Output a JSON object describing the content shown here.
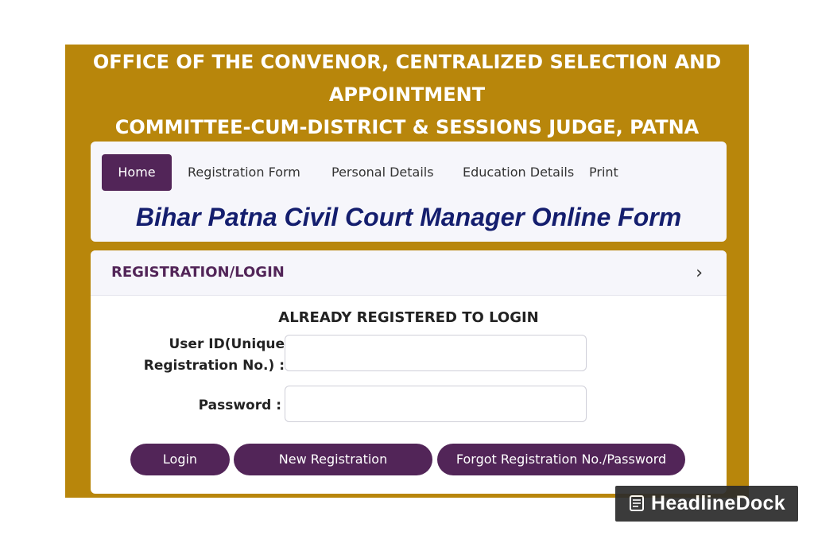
{
  "header": {
    "line1": "OFFICE OF THE CONVENOR, CENTRALIZED SELECTION AND",
    "line2": "APPOINTMENT",
    "line3": "COMMITTEE-CUM-DISTRICT & SESSIONS JUDGE, PATNA"
  },
  "nav": {
    "items": [
      {
        "label": "Home",
        "active": true
      },
      {
        "label": "Registration Form"
      },
      {
        "label": "Personal Details"
      },
      {
        "label": "Education Details"
      },
      {
        "label": "Print"
      }
    ]
  },
  "form_title": "Bihar Patna Civil Court Manager Online Form",
  "panel": {
    "title": "REGISTRATION/LOGIN",
    "chevron": "›",
    "subtitle": "ALREADY REGISTERED TO LOGIN",
    "userid_label_1": "User ID(Unique",
    "userid_label_2": "Registration No.) :",
    "userid_value": "",
    "password_label": "Password :",
    "password_value": ""
  },
  "buttons": {
    "login": "Login",
    "new_registration": "New Registration",
    "forgot": "Forgot Registration No./Password"
  },
  "watermark": {
    "text": "HeadlineDock",
    "icon": "newspaper-icon"
  },
  "colors": {
    "frame": "#b8860b",
    "accent": "#522558",
    "title": "#141e6e"
  }
}
